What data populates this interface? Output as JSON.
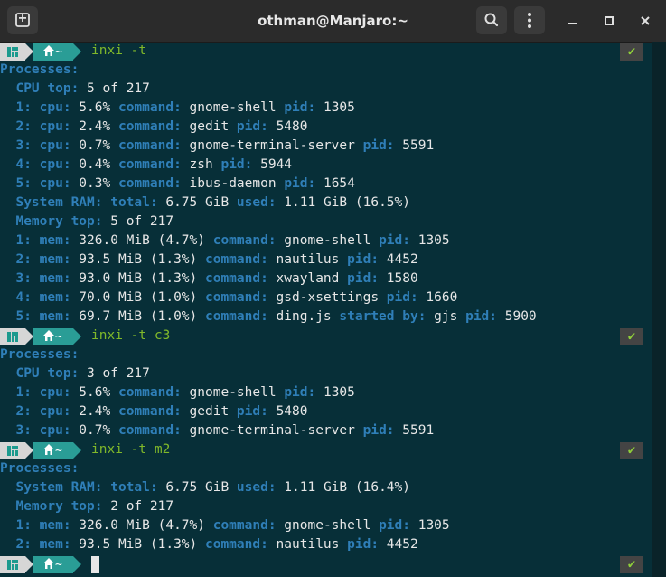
{
  "window": {
    "title": "othman@Manjaro:~",
    "new_tab_icon": "new-tab-icon",
    "search_icon": "search-icon",
    "menu_icon": "kebab-menu-icon"
  },
  "prompt": {
    "dir": "~",
    "success_mark": "✔"
  },
  "colors": {
    "background": "#072f38",
    "label": "#2f7fb8",
    "command": "#80b82a",
    "prompt_dir_bg": "#2a9d96"
  },
  "blocks": [
    {
      "command": "inxi -t",
      "lines": [
        [
          {
            "t": "Processes:",
            "c": "lbl"
          }
        ],
        [
          {
            "t": "  CPU top:",
            "c": "lbl"
          },
          {
            "t": " 5 of 217",
            "c": "val"
          }
        ],
        [
          {
            "t": "  1: cpu:",
            "c": "lbl"
          },
          {
            "t": " 5.6% ",
            "c": "val"
          },
          {
            "t": "command:",
            "c": "lbl"
          },
          {
            "t": " gnome-shell ",
            "c": "val"
          },
          {
            "t": "pid:",
            "c": "lbl"
          },
          {
            "t": " 1305",
            "c": "val"
          }
        ],
        [
          {
            "t": "  2: cpu:",
            "c": "lbl"
          },
          {
            "t": " 2.4% ",
            "c": "val"
          },
          {
            "t": "command:",
            "c": "lbl"
          },
          {
            "t": " gedit ",
            "c": "val"
          },
          {
            "t": "pid:",
            "c": "lbl"
          },
          {
            "t": " 5480",
            "c": "val"
          }
        ],
        [
          {
            "t": "  3: cpu:",
            "c": "lbl"
          },
          {
            "t": " 0.7% ",
            "c": "val"
          },
          {
            "t": "command:",
            "c": "lbl"
          },
          {
            "t": " gnome-terminal-server ",
            "c": "val"
          },
          {
            "t": "pid:",
            "c": "lbl"
          },
          {
            "t": " 5591",
            "c": "val"
          }
        ],
        [
          {
            "t": "  4: cpu:",
            "c": "lbl"
          },
          {
            "t": " 0.4% ",
            "c": "val"
          },
          {
            "t": "command:",
            "c": "lbl"
          },
          {
            "t": " zsh ",
            "c": "val"
          },
          {
            "t": "pid:",
            "c": "lbl"
          },
          {
            "t": " 5944",
            "c": "val"
          }
        ],
        [
          {
            "t": "  5: cpu:",
            "c": "lbl"
          },
          {
            "t": " 0.3% ",
            "c": "val"
          },
          {
            "t": "command:",
            "c": "lbl"
          },
          {
            "t": " ibus-daemon ",
            "c": "val"
          },
          {
            "t": "pid:",
            "c": "lbl"
          },
          {
            "t": " 1654",
            "c": "val"
          }
        ],
        [
          {
            "t": "  System RAM: total:",
            "c": "lbl"
          },
          {
            "t": " 6.75 GiB ",
            "c": "val"
          },
          {
            "t": "used:",
            "c": "lbl"
          },
          {
            "t": " 1.11 GiB (16.5%)",
            "c": "val"
          }
        ],
        [
          {
            "t": "  Memory top:",
            "c": "lbl"
          },
          {
            "t": " 5 of 217",
            "c": "val"
          }
        ],
        [
          {
            "t": "  1: mem:",
            "c": "lbl"
          },
          {
            "t": " 326.0 MiB (4.7%) ",
            "c": "val"
          },
          {
            "t": "command:",
            "c": "lbl"
          },
          {
            "t": " gnome-shell ",
            "c": "val"
          },
          {
            "t": "pid:",
            "c": "lbl"
          },
          {
            "t": " 1305",
            "c": "val"
          }
        ],
        [
          {
            "t": "  2: mem:",
            "c": "lbl"
          },
          {
            "t": " 93.5 MiB (1.3%) ",
            "c": "val"
          },
          {
            "t": "command:",
            "c": "lbl"
          },
          {
            "t": " nautilus ",
            "c": "val"
          },
          {
            "t": "pid:",
            "c": "lbl"
          },
          {
            "t": " 4452",
            "c": "val"
          }
        ],
        [
          {
            "t": "  3: mem:",
            "c": "lbl"
          },
          {
            "t": " 93.0 MiB (1.3%) ",
            "c": "val"
          },
          {
            "t": "command:",
            "c": "lbl"
          },
          {
            "t": " xwayland ",
            "c": "val"
          },
          {
            "t": "pid:",
            "c": "lbl"
          },
          {
            "t": " 1580",
            "c": "val"
          }
        ],
        [
          {
            "t": "  4: mem:",
            "c": "lbl"
          },
          {
            "t": " 70.0 MiB (1.0%) ",
            "c": "val"
          },
          {
            "t": "command:",
            "c": "lbl"
          },
          {
            "t": " gsd-xsettings ",
            "c": "val"
          },
          {
            "t": "pid:",
            "c": "lbl"
          },
          {
            "t": " 1660",
            "c": "val"
          }
        ],
        [
          {
            "t": "  5: mem:",
            "c": "lbl"
          },
          {
            "t": " 69.7 MiB (1.0%) ",
            "c": "val"
          },
          {
            "t": "command:",
            "c": "lbl"
          },
          {
            "t": " ding.js ",
            "c": "val"
          },
          {
            "t": "started by:",
            "c": "lbl"
          },
          {
            "t": " gjs ",
            "c": "val"
          },
          {
            "t": "pid:",
            "c": "lbl"
          },
          {
            "t": " 5900",
            "c": "val"
          }
        ]
      ]
    },
    {
      "command": "inxi -t c3",
      "lines": [
        [
          {
            "t": "Processes:",
            "c": "lbl"
          }
        ],
        [
          {
            "t": "  CPU top:",
            "c": "lbl"
          },
          {
            "t": " 3 of 217",
            "c": "val"
          }
        ],
        [
          {
            "t": "  1: cpu:",
            "c": "lbl"
          },
          {
            "t": " 5.6% ",
            "c": "val"
          },
          {
            "t": "command:",
            "c": "lbl"
          },
          {
            "t": " gnome-shell ",
            "c": "val"
          },
          {
            "t": "pid:",
            "c": "lbl"
          },
          {
            "t": " 1305",
            "c": "val"
          }
        ],
        [
          {
            "t": "  2: cpu:",
            "c": "lbl"
          },
          {
            "t": " 2.4% ",
            "c": "val"
          },
          {
            "t": "command:",
            "c": "lbl"
          },
          {
            "t": " gedit ",
            "c": "val"
          },
          {
            "t": "pid:",
            "c": "lbl"
          },
          {
            "t": " 5480",
            "c": "val"
          }
        ],
        [
          {
            "t": "  3: cpu:",
            "c": "lbl"
          },
          {
            "t": " 0.7% ",
            "c": "val"
          },
          {
            "t": "command:",
            "c": "lbl"
          },
          {
            "t": " gnome-terminal-server ",
            "c": "val"
          },
          {
            "t": "pid:",
            "c": "lbl"
          },
          {
            "t": " 5591",
            "c": "val"
          }
        ]
      ]
    },
    {
      "command": "inxi -t m2",
      "lines": [
        [
          {
            "t": "Processes:",
            "c": "lbl"
          }
        ],
        [
          {
            "t": "  System RAM: total:",
            "c": "lbl"
          },
          {
            "t": " 6.75 GiB ",
            "c": "val"
          },
          {
            "t": "used:",
            "c": "lbl"
          },
          {
            "t": " 1.11 GiB (16.4%)",
            "c": "val"
          }
        ],
        [
          {
            "t": "  Memory top:",
            "c": "lbl"
          },
          {
            "t": " 2 of 217",
            "c": "val"
          }
        ],
        [
          {
            "t": "  1: mem:",
            "c": "lbl"
          },
          {
            "t": " 326.0 MiB (4.7%) ",
            "c": "val"
          },
          {
            "t": "command:",
            "c": "lbl"
          },
          {
            "t": " gnome-shell ",
            "c": "val"
          },
          {
            "t": "pid:",
            "c": "lbl"
          },
          {
            "t": " 1305",
            "c": "val"
          }
        ],
        [
          {
            "t": "  2: mem:",
            "c": "lbl"
          },
          {
            "t": " 93.5 MiB (1.3%) ",
            "c": "val"
          },
          {
            "t": "command:",
            "c": "lbl"
          },
          {
            "t": " nautilus ",
            "c": "val"
          },
          {
            "t": "pid:",
            "c": "lbl"
          },
          {
            "t": " 4452",
            "c": "val"
          }
        ]
      ]
    }
  ]
}
